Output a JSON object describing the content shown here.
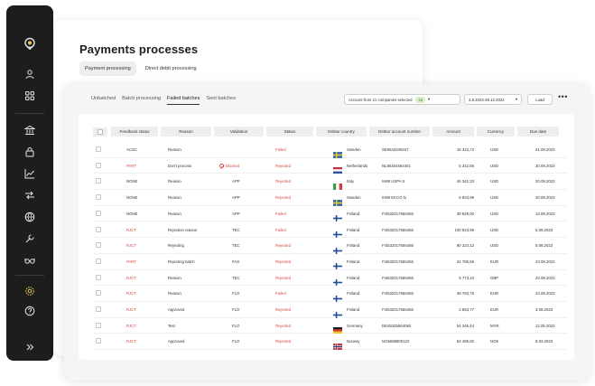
{
  "sidebar": {
    "icons": [
      "logo-icon",
      "user-icon",
      "apps-icon",
      "bank-icon",
      "lock-icon",
      "chart-icon",
      "transfer-icon",
      "globe-icon",
      "wrench-icon",
      "glasses-icon",
      "settings-icon",
      "help-icon",
      "expand-icon"
    ]
  },
  "page": {
    "title": "Payments processes",
    "tabs": [
      {
        "label": "Payment processing",
        "active": true
      },
      {
        "label": "Direct debit processing",
        "active": false
      }
    ]
  },
  "toolbar": {
    "sub_tabs": [
      {
        "label": "Unbatched"
      },
      {
        "label": "Batch processing"
      },
      {
        "label": "Failed batches",
        "active": true
      },
      {
        "label": "Sent batches"
      }
    ],
    "company_select": "Account from 21 companies selected",
    "company_count": "93",
    "date_range": "3.8.2023-28.12.2024",
    "load_label": "Load",
    "more": "•••"
  },
  "table": {
    "headers": [
      "Feedback status",
      "Reason",
      "Validation",
      "Status",
      "Debtor country",
      "Debtor account number",
      "Amount",
      "Currency",
      "Due date"
    ],
    "rows": [
      {
        "feedback": "ACSC",
        "reason": "Reason",
        "validation": "",
        "status": "Failed",
        "country": "Sweden",
        "flag": "se",
        "account": "SE6643348247",
        "amount": "15 322,72",
        "currency": "USD",
        "due": "21.09.2023"
      },
      {
        "feedback": "PART",
        "reason": "Don't process",
        "validation": "Blocked",
        "status": "Rejected",
        "country": "Netherlands",
        "flag": "nl",
        "account": "NL86454564401",
        "amount": "5 342,56",
        "currency": "USD",
        "due": "20.09.2023"
      },
      {
        "feedback": "NONE",
        "reason": "Reason",
        "validation": "APP",
        "status": "Rejected",
        "country": "Italy",
        "flag": "it",
        "account": "IH89 USPA 5",
        "amount": "46 342,33",
        "currency": "USD",
        "due": "20.09.2023"
      },
      {
        "feedback": "NONE",
        "reason": "Reason",
        "validation": "APP",
        "status": "Rejected",
        "country": "Sweden",
        "flag": "se",
        "account": "IH89 EKCO N",
        "amount": "6 823,99",
        "currency": "USD",
        "due": "20.09.2023"
      },
      {
        "feedback": "NONE",
        "reason": "Reason",
        "validation": "APP",
        "status": "Failed",
        "country": "Finland",
        "flag": "fi",
        "account": "FI4532017656456",
        "amount": "30 829,00",
        "currency": "USD",
        "due": "13.09.2023"
      },
      {
        "feedback": "RJCT",
        "reason": "Rejection reason",
        "validation": "TEC",
        "status": "Failed",
        "country": "Finland",
        "flag": "fi",
        "account": "FI4532017656456",
        "amount": "100 823,99",
        "currency": "USD",
        "due": "5.09.2023"
      },
      {
        "feedback": "RJCT",
        "reason": "Rejecting",
        "validation": "TEC",
        "status": "Rejected",
        "country": "Finland",
        "flag": "fi",
        "account": "FI4532017656456",
        "amount": "80 223,12",
        "currency": "USD",
        "due": "5.09.2023"
      },
      {
        "feedback": "PART",
        "reason": "Rejecting batch",
        "validation": "FAS",
        "status": "Rejected",
        "country": "Finland",
        "flag": "fi",
        "account": "FI4532017656456",
        "amount": "34 785,56",
        "currency": "EUR",
        "due": "23.08.2023"
      },
      {
        "feedback": "RJCT",
        "reason": "Reason",
        "validation": "TEC",
        "status": "Rejected",
        "country": "Finland",
        "flag": "fi",
        "account": "FI4532017656456",
        "amount": "5 773,10",
        "currency": "GBP",
        "due": "23.08.2023"
      },
      {
        "feedback": "RJCT",
        "reason": "Reason",
        "validation": "FLO",
        "status": "Failed",
        "country": "Finland",
        "flag": "fi",
        "account": "FI4532017656456",
        "amount": "46 783,75",
        "currency": "EUR",
        "due": "23.08.2023"
      },
      {
        "feedback": "RJCT",
        "reason": "Approved",
        "validation": "FLO",
        "status": "Rejected",
        "country": "Finland",
        "flag": "fi",
        "account": "FI4532017656456",
        "amount": "2 853,77",
        "currency": "EUR",
        "due": "3.08.2023"
      },
      {
        "feedback": "RJCT",
        "reason": "Test",
        "validation": "FLO",
        "status": "Rejected",
        "country": "Germany",
        "flag": "de",
        "account": "DE45325564092",
        "amount": "54 346,44",
        "currency": "MYR",
        "due": "12.05.2023"
      },
      {
        "feedback": "RJCT",
        "reason": "Approved",
        "validation": "FLO",
        "status": "Rejected",
        "country": "Norway",
        "flag": "no",
        "account": "NO5698800122",
        "amount": "54 495,82",
        "currency": "NOK",
        "due": "8.03.2023"
      }
    ]
  },
  "colors": {
    "accent_red": "#d24a3f",
    "sidebar_bg": "#1d1d1d",
    "highlight_yellow": "#e8c547"
  }
}
